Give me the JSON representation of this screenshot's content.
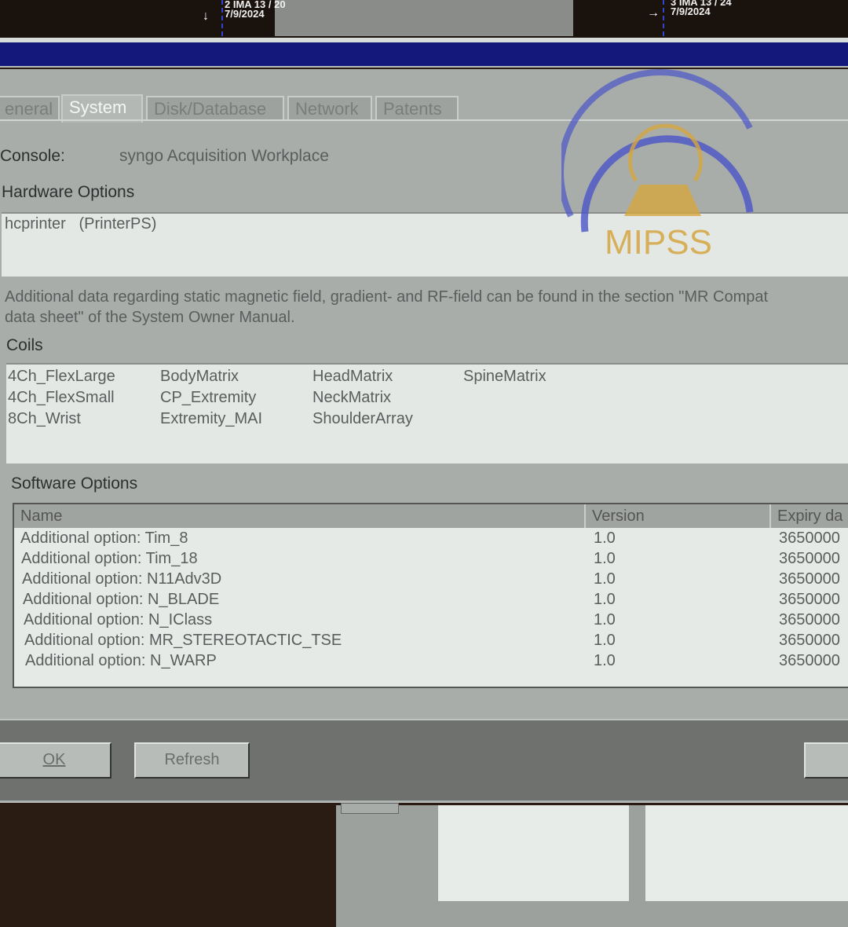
{
  "viewer": {
    "images": [
      {
        "label": "2 IMA 13 / 20",
        "date": "7/9/2024",
        "arrow": "↓"
      },
      {
        "label": "3 IMA 13 / 24",
        "date": "7/9/2024",
        "arrow": "→"
      }
    ]
  },
  "tabs": [
    {
      "label": "eneral"
    },
    {
      "label": "System",
      "active": true
    },
    {
      "label": "Disk/Database"
    },
    {
      "label": "Network"
    },
    {
      "label": "Patents"
    }
  ],
  "console": {
    "label": "Console:",
    "value": "syngo Acquisition Workplace"
  },
  "hardware": {
    "title": "Hardware Options",
    "items": [
      "hcprinter   (PrinterPS)"
    ]
  },
  "note": {
    "line1": "Additional data regarding static magnetic field, gradient- and RF-field can be found in the section \"MR Compat",
    "line2": "data sheet\" of the System Owner Manual."
  },
  "coils": {
    "title": "Coils",
    "columns": [
      [
        "4Ch_FlexLarge",
        "4Ch_FlexSmall",
        "8Ch_Wrist"
      ],
      [
        "BodyMatrix",
        "CP_Extremity",
        "Extremity_MAI"
      ],
      [
        "HeadMatrix",
        "NeckMatrix",
        "ShoulderArray"
      ],
      [
        "SpineMatrix"
      ]
    ]
  },
  "software": {
    "title": "Software Options",
    "headers": [
      "Name",
      "Version",
      "Expiry da"
    ],
    "rows": [
      [
        "Additional option: Tim_8",
        "1.0",
        "3650000"
      ],
      [
        "Additional option: Tim_18",
        "1.0",
        "3650000"
      ],
      [
        "Additional option: N11Adv3D",
        "1.0",
        "3650000"
      ],
      [
        "Additional option: N_BLADE",
        "1.0",
        "3650000"
      ],
      [
        "Additional option: N_IClass",
        "1.0",
        "3650000"
      ],
      [
        "Additional option: MR_STEREOTACTIC_TSE",
        "1.0",
        "3650000"
      ],
      [
        "Additional option: N_WARP",
        "1.0",
        "3650000"
      ]
    ]
  },
  "buttons": {
    "ok": "OK",
    "refresh": "Refresh"
  },
  "watermark": {
    "text": "MIPSS",
    "colors": {
      "arc": "#4a55c8",
      "gold": "#d4a640"
    }
  }
}
